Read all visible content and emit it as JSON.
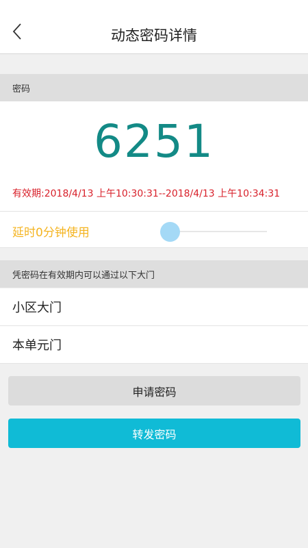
{
  "header": {
    "title": "动态密码详情",
    "back_icon": "chevron-left-icon"
  },
  "password_section": {
    "label": "密码",
    "code": "6251",
    "code_color": "#138a86",
    "validity": "有效期:2018/4/13 上午10:30:31--2018/4/13 上午10:34:31",
    "validity_color": "#d8202a"
  },
  "delay": {
    "label": "延时0分钟使用",
    "label_color": "#f4b421",
    "slider_value": 0
  },
  "gates_section": {
    "label": "凭密码在有效期内可以通过以下大门",
    "items": [
      "小区大门",
      "本单元门"
    ]
  },
  "buttons": {
    "apply_label": "申请密码",
    "forward_label": "转发密码",
    "forward_color": "#10bbd6"
  }
}
